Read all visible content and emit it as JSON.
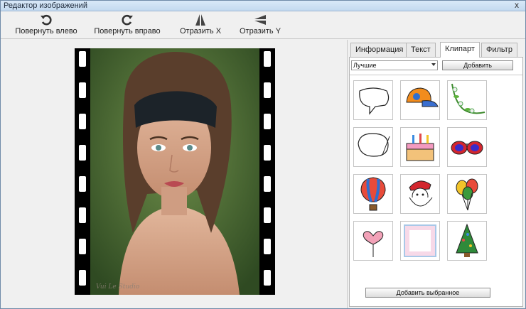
{
  "window": {
    "title": "Редактор изображений",
    "close_glyph": "x"
  },
  "toolbar": {
    "buttons": [
      {
        "label": "Повернуть влево",
        "icon": "rotate-left-icon"
      },
      {
        "label": "Повернуть вправо",
        "icon": "rotate-right-icon"
      },
      {
        "label": "Отразить X",
        "icon": "flip-x-icon"
      },
      {
        "label": "Отразить Y",
        "icon": "flip-y-icon"
      }
    ]
  },
  "canvas": {
    "watermark": "Vui Le Studio"
  },
  "side_panel": {
    "tabs": [
      {
        "label": "Информация",
        "active": false
      },
      {
        "label": "Текст",
        "active": false
      },
      {
        "label": "Клипарт",
        "active": true
      },
      {
        "label": "Фильтр",
        "active": false
      }
    ],
    "category_select": {
      "value": "Лучшие"
    },
    "add_button": "Добавить",
    "add_selected_button": "Добавить выбранное",
    "cliparts": [
      {
        "icon": "speech-bubble-icon"
      },
      {
        "icon": "cap-icon"
      },
      {
        "icon": "flower-corner-icon"
      },
      {
        "icon": "thought-bubble-icon"
      },
      {
        "icon": "birthday-cake-icon"
      },
      {
        "icon": "sunglasses-icon"
      },
      {
        "icon": "hot-air-balloon-icon"
      },
      {
        "icon": "santa-icon"
      },
      {
        "icon": "balloons-icon"
      },
      {
        "icon": "heart-balloons-icon"
      },
      {
        "icon": "photo-frame-icon"
      },
      {
        "icon": "christmas-tree-icon"
      }
    ]
  }
}
